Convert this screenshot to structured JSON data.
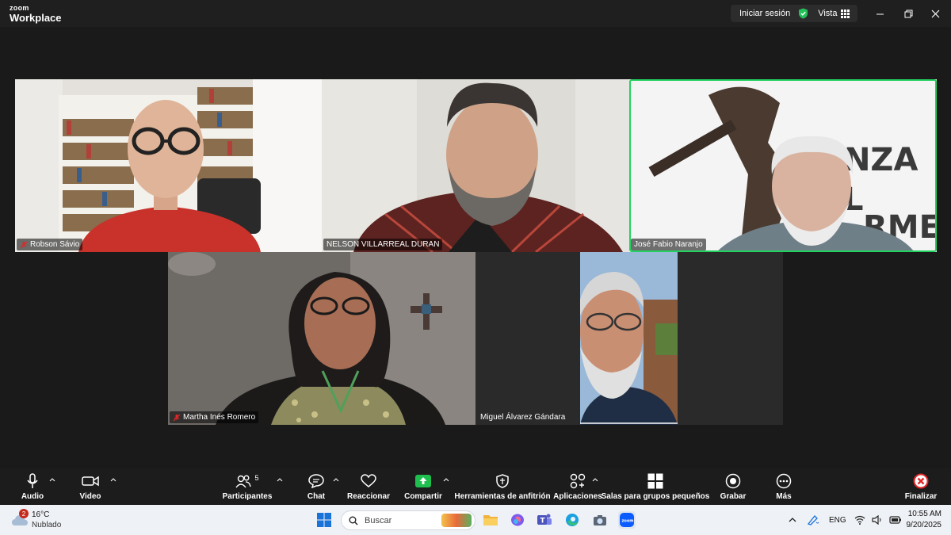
{
  "app": {
    "logo_top": "zoom",
    "logo_bottom": "Workplace"
  },
  "titlebar": {
    "signin_label": "Iniciar sesión",
    "view_label": "Vista"
  },
  "participants": [
    {
      "name": "Robson Sávio",
      "muted": true
    },
    {
      "name": "NELSON VILLARREAL DURAN",
      "muted": false
    },
    {
      "name": "José Fabio Naranjo",
      "muted": false,
      "active_speaker": true
    },
    {
      "name": "Martha Inés Romero",
      "muted": true
    },
    {
      "name": "Miguel Álvarez Gándara",
      "muted": false
    }
  ],
  "toolbar": {
    "audio": "Audio",
    "video": "Video",
    "participants": "Participantes",
    "participants_count": "5",
    "chat": "Chat",
    "react": "Reaccionar",
    "share": "Compartir",
    "host_tools": "Herramientas de anfitrión",
    "apps": "Aplicaciones",
    "breakout": "Salas para grupos pequeños",
    "record": "Grabar",
    "more": "Más",
    "end": "Finalizar"
  },
  "taskbar": {
    "weather_temp": "16°C",
    "weather_cond": "Nublado",
    "weather_badge": "2",
    "search_placeholder": "Buscar",
    "language": "ENG",
    "time": "10:55 AM",
    "date": "9/20/2025"
  },
  "colors": {
    "accent_green": "#23d160",
    "share_green": "#1fbf4f",
    "end_red": "#e02828",
    "background": "#1a1a1a"
  },
  "icons": [
    "microphone-icon",
    "camera-icon",
    "participants-icon",
    "chat-icon",
    "heart-icon",
    "share-screen-icon",
    "shield-icon",
    "apps-icon",
    "breakout-icon",
    "record-icon",
    "more-icon",
    "end-icon"
  ]
}
